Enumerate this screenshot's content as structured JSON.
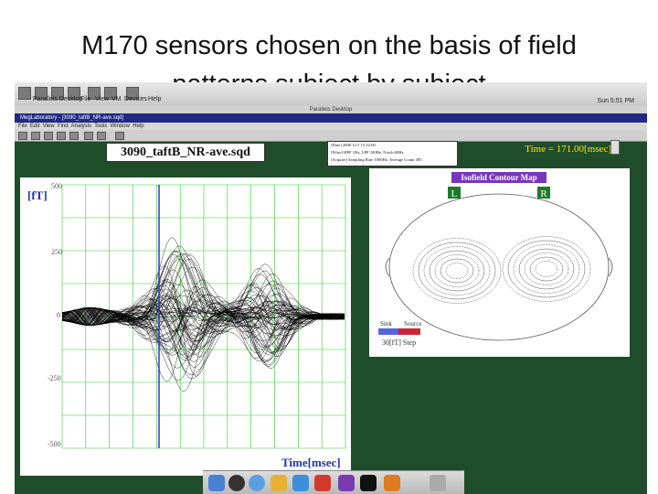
{
  "slide": {
    "title_line1": "M170 sensors chosen on the basis of field",
    "title_line2": "patterns subject by subject"
  },
  "os": {
    "menu": [
      "Parallels Desktop",
      "File",
      "View",
      "VM",
      "Devices",
      "Help"
    ],
    "clock": "Sun 5:51 PM",
    "vm_title": "Parallels Desktop",
    "window_label": "Stereo:2"
  },
  "app": {
    "title": "MegLaboratory - [3090_taftB_NR-ave.sqd]",
    "menu": [
      "File",
      "Edit",
      "View",
      "Find",
      "Analysis",
      "Tools",
      "Window",
      "Help"
    ],
    "filename": "3090_taftB_NR-ave.sqd",
    "info": [
      "[Date] 2006.12.5 15:32:00",
      "[Filter] HPF 1Hz, LPF 100Hz, Notch 60Hz",
      "[Acquire] Sampling Rate 1000Hz, Average Count 385"
    ],
    "time_label": "Time = 171.00[msec]"
  },
  "waveform": {
    "ylabel": "[fT]",
    "xlabel": "Time[msec]",
    "yticks": [
      "500",
      "250",
      "0",
      "-250",
      "-500"
    ],
    "colors": {
      "background": "#ffffff",
      "grid": "#33cc33",
      "cursor": "#3333cc",
      "trace": "#000000"
    }
  },
  "isofield": {
    "title": "Isofield Contour Map",
    "left": "L",
    "right": "R",
    "sink": "Sink",
    "source": "Source",
    "step": "30[fT] Step",
    "colors": {
      "title_bg": "#7a35c0",
      "lr_bg": "#1a7a2a"
    }
  },
  "dock": {
    "icons": [
      "finder-icon",
      "dashboard-icon",
      "safari-icon",
      "ichat-icon",
      "itunes-icon",
      "parallels-icon",
      "terminal-icon",
      "matlab-icon",
      "trash-icon"
    ]
  }
}
